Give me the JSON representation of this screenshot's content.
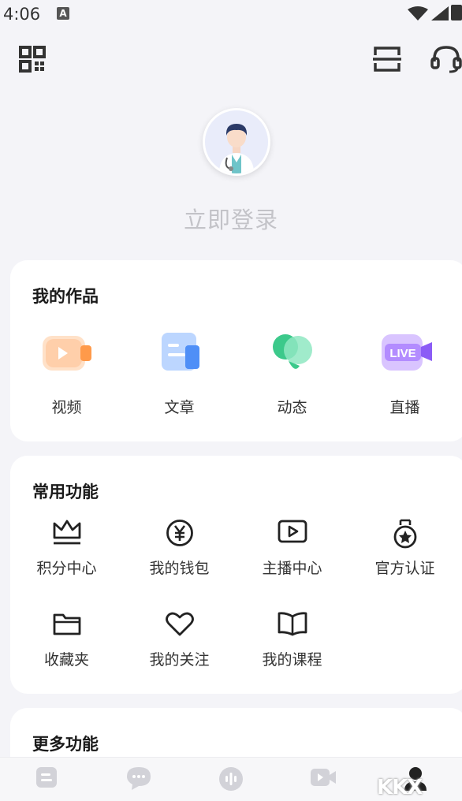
{
  "status_bar": {
    "time": "4:06",
    "notification_badge": "A"
  },
  "profile": {
    "login_text": "立即登录",
    "avatar_icon": "doctor-avatar"
  },
  "works": {
    "title": "我的作品",
    "items": [
      {
        "label": "视频",
        "icon": "video-icon"
      },
      {
        "label": "文章",
        "icon": "article-icon"
      },
      {
        "label": "动态",
        "icon": "moments-icon"
      },
      {
        "label": "直播",
        "icon": "live-icon",
        "badge": "LIVE"
      }
    ]
  },
  "common": {
    "title": "常用功能",
    "items": [
      {
        "label": "积分中心",
        "icon": "crown-icon"
      },
      {
        "label": "我的钱包",
        "icon": "yen-icon"
      },
      {
        "label": "主播中心",
        "icon": "play-screen-icon"
      },
      {
        "label": "官方认证",
        "icon": "medal-icon"
      },
      {
        "label": "收藏夹",
        "icon": "folder-icon"
      },
      {
        "label": "我的关注",
        "icon": "heart-icon"
      },
      {
        "label": "我的课程",
        "icon": "book-icon"
      }
    ]
  },
  "more": {
    "title": "更多功能"
  },
  "tabbar": {
    "tabs": [
      {
        "icon": "home-doc-icon"
      },
      {
        "icon": "chat-icon"
      },
      {
        "icon": "audio-icon"
      },
      {
        "icon": "video-camera-icon"
      },
      {
        "icon": "profile-icon",
        "active": true
      }
    ]
  },
  "watermark": "KKX"
}
